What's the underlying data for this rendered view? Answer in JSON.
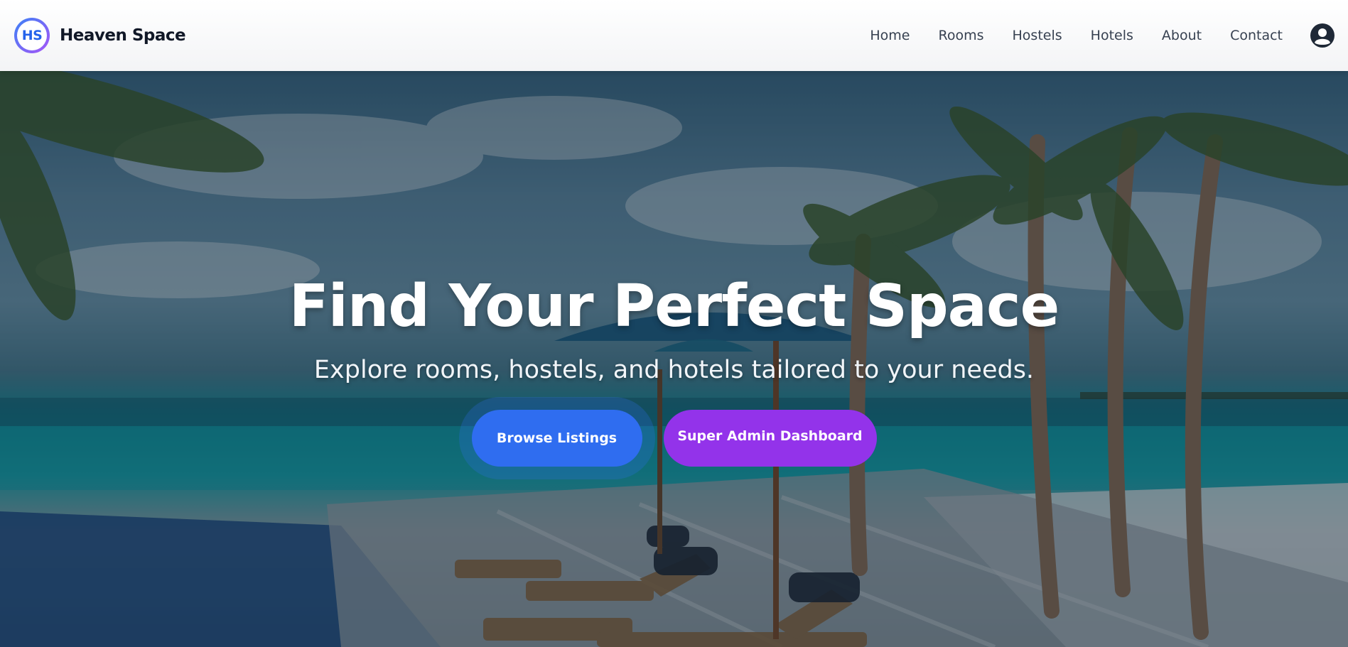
{
  "brand": {
    "logo_text": "HS",
    "name": "Heaven Space"
  },
  "nav": {
    "links": [
      {
        "label": "Home"
      },
      {
        "label": "Rooms"
      },
      {
        "label": "Hostels"
      },
      {
        "label": "Hotels"
      },
      {
        "label": "About"
      },
      {
        "label": "Contact"
      }
    ],
    "user_icon": "user-circle-icon"
  },
  "hero": {
    "title": "Find Your Perfect Space",
    "subtitle": "Explore rooms, hostels, and hotels tailored to your needs.",
    "primary_button": "Browse Listings",
    "secondary_button": "Super Admin Dashboard",
    "background_description_icon": "beach-resort-image"
  },
  "colors": {
    "primary": "#2f6df0",
    "secondary": "#9333ea",
    "brand_text": "#111827",
    "nav_text": "#374151"
  }
}
